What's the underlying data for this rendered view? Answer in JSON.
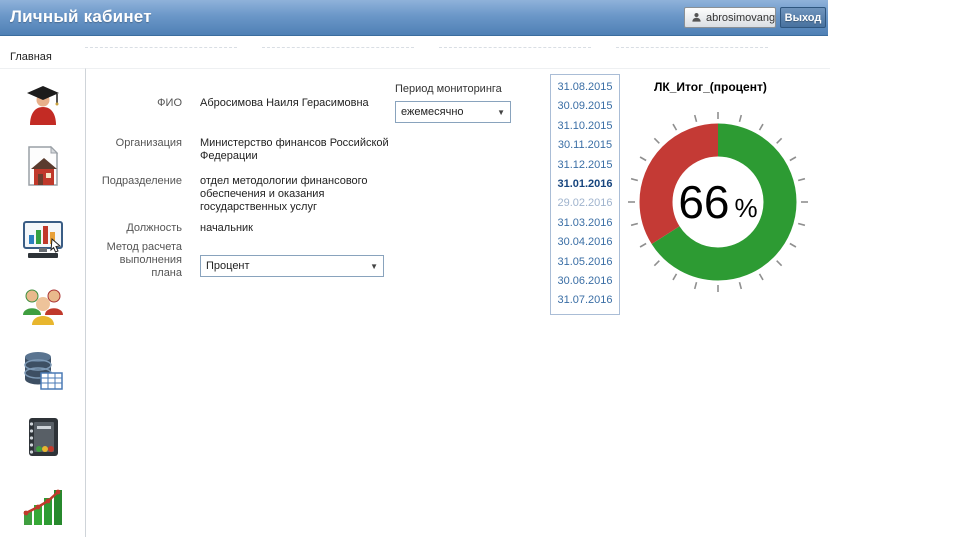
{
  "header": {
    "title": "Личный кабинет",
    "user": "abrosimovang",
    "logout": "Выход"
  },
  "nav": {
    "home": "Главная"
  },
  "sidebar": {
    "items": [
      {
        "icon": "student-icon"
      },
      {
        "icon": "organization-icon"
      },
      {
        "icon": "monitoring-icon"
      },
      {
        "icon": "users-icon"
      },
      {
        "icon": "database-icon"
      },
      {
        "icon": "reports-icon"
      },
      {
        "icon": "statistics-icon"
      }
    ]
  },
  "profile": {
    "fio_label": "ФИО",
    "fio_value": "Абросимова Наиля Герасимовна",
    "org_label": "Организация",
    "org_value": "Министерство финансов Российской Федерации",
    "dept_label": "Подразделение",
    "dept_value": "отдел методологии финансового обеспечения и оказания государственных услуг",
    "post_label": "Должность",
    "post_value": "начальник",
    "method_label": "Метод расчета выполнения плана",
    "method_value": "Процент"
  },
  "monitoring": {
    "label": "Период мониторинга",
    "value": "ежемесячно"
  },
  "dates": {
    "items": [
      "31.08.2015",
      "30.09.2015",
      "31.10.2015",
      "30.11.2015",
      "31.12.2015",
      "31.01.2016",
      "29.02.2016",
      "31.03.2016",
      "30.04.2016",
      "31.05.2016",
      "30.06.2016",
      "31.07.2016"
    ],
    "selected": "31.01.2016",
    "muted": "29.02.2016"
  },
  "chart_data": {
    "type": "pie",
    "donut": true,
    "title": "ЛК_Итог_(процент)",
    "center_value": "66",
    "center_unit": "%",
    "segments": [
      {
        "value": 66,
        "color": "#2d9b33"
      },
      {
        "value": 34,
        "color": "#c43a35"
      }
    ],
    "start_angle_deg": -90,
    "direction": "clockwise",
    "tick_count": 24,
    "tick_color": "#8f8f8f"
  },
  "colors": {
    "header_top": "#8fb2da",
    "header_bottom": "#4f80b5",
    "date_link": "#3a6ea5",
    "date_selected": "#17457e"
  }
}
